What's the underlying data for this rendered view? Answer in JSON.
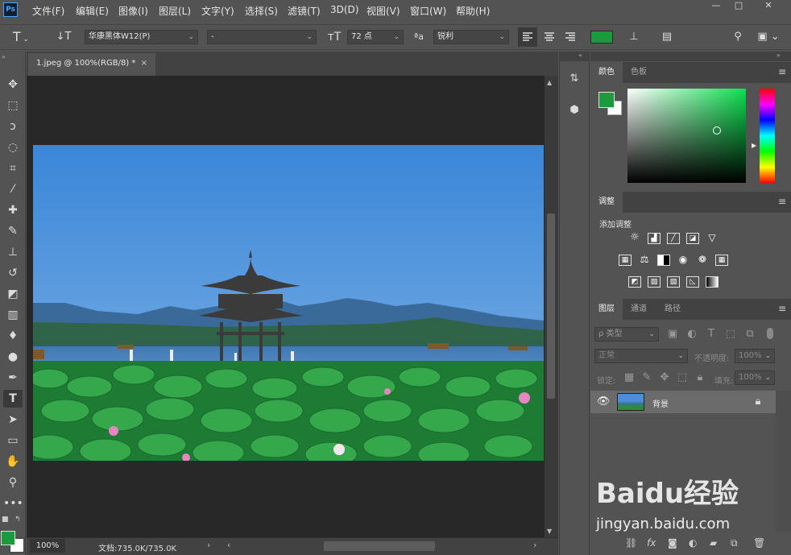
{
  "app": {
    "logo": "Ps"
  },
  "menu": [
    "文件(F)",
    "编辑(E)",
    "图像(I)",
    "图层(L)",
    "文字(Y)",
    "选择(S)",
    "滤镜(T)",
    "3D(D)",
    "视图(V)",
    "窗口(W)",
    "帮助(H)"
  ],
  "window_controls": {
    "minimize": "—",
    "maximize": "□",
    "close": "✕"
  },
  "options": {
    "font_family": "华康黑体W12(P)",
    "font_style": "-",
    "font_size": "72 点",
    "antialias_icon_label": "ªa",
    "antialias": "锐利",
    "text_color": "#1e9a3e"
  },
  "document": {
    "tab_title": "1.jpeg @ 100%(RGB/8) *",
    "tab_close": "×",
    "zoom": "100%",
    "doc_info": "文档:735.0K/735.0K"
  },
  "colors": {
    "foreground": "#1e9a3e",
    "background": "#ffffff"
  },
  "panels": {
    "color_tabs": [
      "颜色",
      "色板"
    ],
    "adjust_tab": "调整",
    "adjust_add_label": "添加调整",
    "layers_tabs": [
      "图层",
      "通道",
      "路径"
    ],
    "kind_filter": "ρ 类型",
    "blend_mode": "正常",
    "opacity_label": "不透明度:",
    "opacity_value": "100%",
    "lock_label": "锁定:",
    "fill_label": "填充:",
    "fill_value": "100%",
    "layers": [
      {
        "name": "背景",
        "visible": true,
        "locked": true
      }
    ]
  },
  "watermark": {
    "brand": "Baidu经验",
    "url": "jingyan.baidu.com"
  }
}
